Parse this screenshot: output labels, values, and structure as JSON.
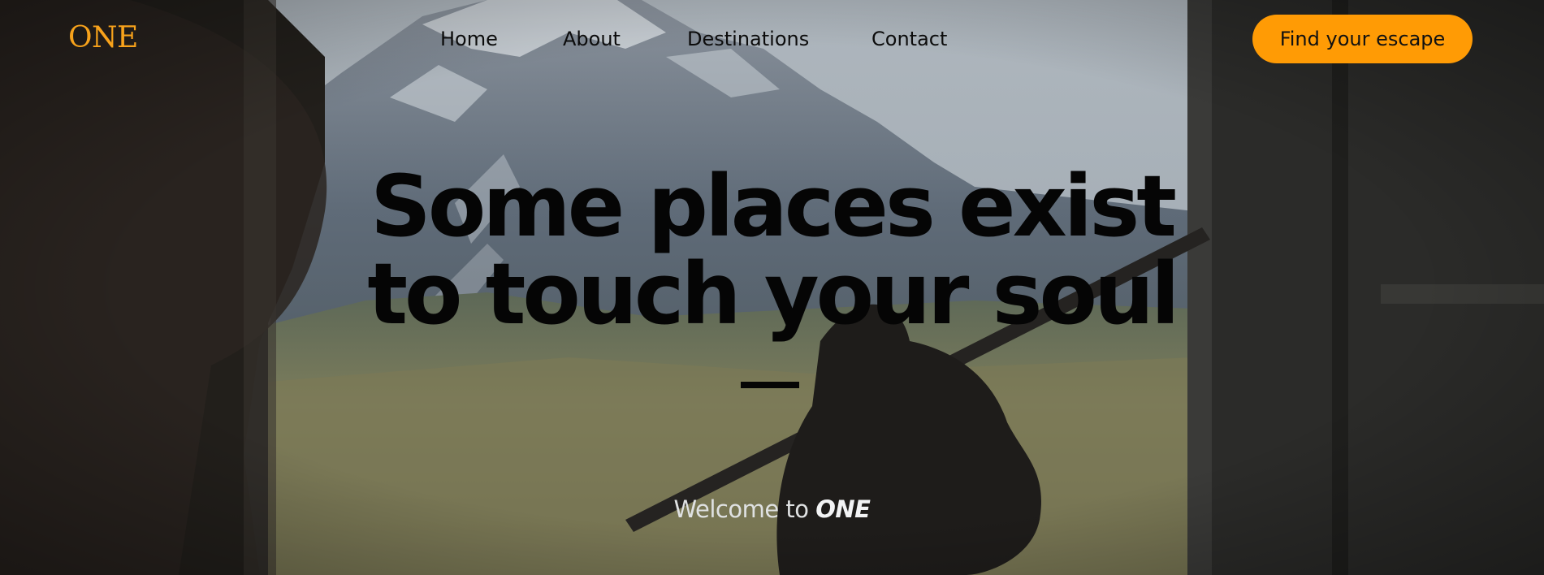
{
  "brand": {
    "logo_text": "ONE",
    "logo_color": "#f7a21b"
  },
  "nav": {
    "items": [
      {
        "label": "Home"
      },
      {
        "label": "About"
      },
      {
        "label": "Destinations"
      },
      {
        "label": "Contact"
      }
    ]
  },
  "cta": {
    "label": "Find your escape",
    "color": "#ff9b05"
  },
  "hero": {
    "headline_line1": "Some places exist",
    "headline_line2": "to touch your soul",
    "welcome_prefix": "Welcome to ",
    "welcome_brand": "ONE"
  }
}
